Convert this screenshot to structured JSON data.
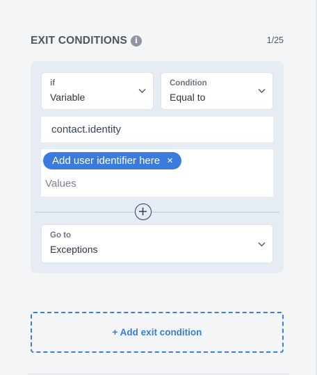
{
  "section": {
    "title": "EXIT CONDITIONS",
    "info_icon": "i",
    "counter": "1/25"
  },
  "condition": {
    "if_select": {
      "label": "if",
      "value": "Variable"
    },
    "condition_select": {
      "label": "Condition",
      "value": "Equal to"
    },
    "variable_input": {
      "value": "contact.identity"
    },
    "values": {
      "chips": [
        {
          "text": "Add user identifier here",
          "remove": "×"
        }
      ],
      "placeholder": "Values"
    },
    "goto_select": {
      "label": "Go to",
      "value": "Exceptions"
    }
  },
  "add_exit_button": {
    "label": "+ Add exit condition"
  },
  "colors": {
    "accent": "#3a7bdc",
    "card": "#e5ecf3",
    "background": "#f4f5f6"
  },
  "icons": {
    "info": "info-icon",
    "chevron": "chevron-down-icon",
    "add": "plus-circle-icon",
    "remove": "close-icon"
  }
}
